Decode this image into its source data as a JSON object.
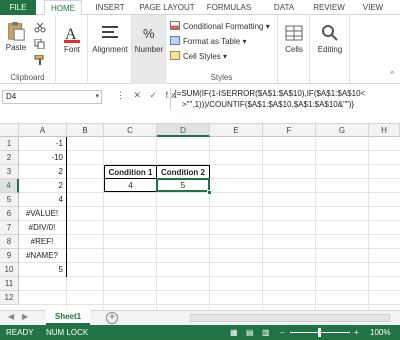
{
  "tabs": [
    "FILE",
    "HOME",
    "INSERT",
    "PAGE LAYOUT",
    "FORMULAS",
    "DATA",
    "REVIEW",
    "VIEW"
  ],
  "ribbon": {
    "paste": "Paste",
    "clipboard": "Clipboard",
    "font": "Font",
    "alignment": "Alignment",
    "number": "Number",
    "cond_format": "Conditional Formatting",
    "format_table": "Format as Table",
    "cell_styles": "Cell Styles",
    "styles": "Styles",
    "cells": "Cells",
    "editing": "Editing"
  },
  "namebox": "D4",
  "fx_icons": "⋮ ✕ ✓ fx",
  "formula": "{=SUM(IF(1-ISERROR($A$1:$A$10),IF($A$1:$A$10<>\"\",1)))/COUNTIF($A$1:$A$10,$A$1:$A$10&\"\")}",
  "formula_line1": "{=SUM(IF(1-ISERROR($A$1:$A$10),IF($A$1:$A$10<",
  "formula_line2": ">\"\",1)))/COUNTIF($A$1:$A$10,$A$1:$A$10&\"\")}",
  "columns": [
    "A",
    "B",
    "C",
    "D",
    "E",
    "F",
    "G",
    "H"
  ],
  "rows": [
    "1",
    "2",
    "3",
    "4",
    "5",
    "6",
    "7",
    "8",
    "9",
    "10",
    "11",
    "12"
  ],
  "col_a_values": [
    "-1",
    "-10",
    "2",
    "2",
    "4",
    "#VALUE!",
    "#DIV/0!",
    "#REF!",
    "#NAME?",
    "5"
  ],
  "header_c3": "Condition 1",
  "header_d3": "Condition 2",
  "value_c4": "4",
  "value_d4": "5",
  "sheet_tab": "Sheet1",
  "status": {
    "ready": "READY",
    "numlock": "NUM LOCK",
    "zoom": "100%"
  }
}
